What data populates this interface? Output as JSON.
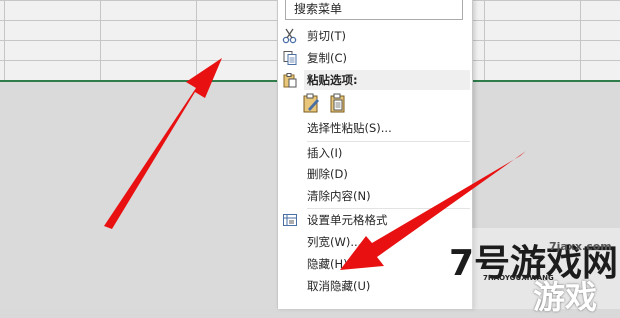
{
  "menu": {
    "search_placeholder": "搜索菜单",
    "items": {
      "cut": "剪切(T)",
      "copy": "复制(C)",
      "paste_options": "粘贴选项:",
      "paste_special": "选择性粘贴(S)...",
      "insert": "插入(I)",
      "delete": "删除(D)",
      "clear_contents": "清除内容(N)",
      "format_cells": "设置单元格格式",
      "column_width": "列宽(W)...",
      "hide": "隐藏(H)",
      "unhide": "取消隐藏(U)"
    },
    "icons": [
      "scissors-icon",
      "copy-icon",
      "clipboard-icon",
      "paste-icon",
      "paste-values-icon",
      "format-cells-icon"
    ]
  },
  "watermark": {
    "big": "7号游戏网",
    "small": "7HAOYOUXIWANG",
    "domain": "7jaxx.com",
    "sub": "游戏"
  },
  "colors": {
    "arrow": "#e81010",
    "sheet_border": "#2e7d4a",
    "menu_bg": "#ffffff"
  }
}
